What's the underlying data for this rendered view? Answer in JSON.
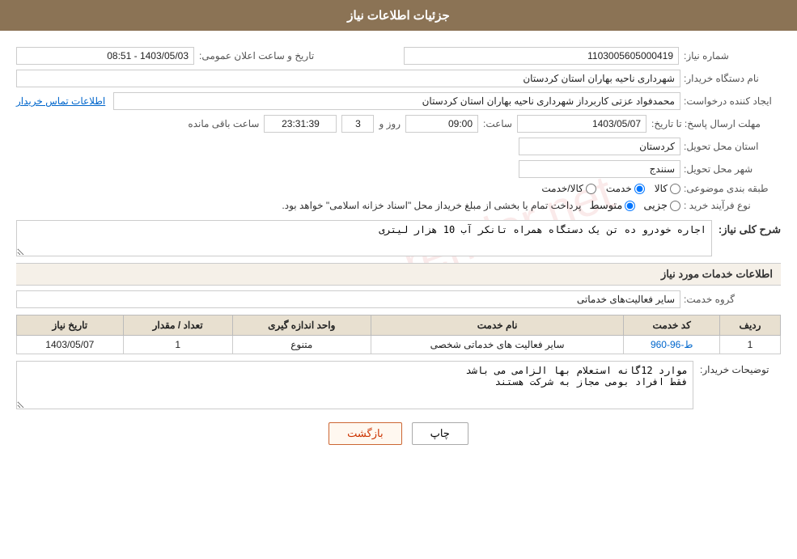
{
  "header": {
    "title": "جزئيات اطلاعات نياز"
  },
  "fields": {
    "shenmareh_niaz_label": "شماره نياز:",
    "shenmareh_niaz_value": "1103005605000419",
    "name_dastgah_label": "نام دستگاه خريدار:",
    "name_dastgah_value": "شهرداری ناحيه بهاران استان کردستان",
    "ijad_konandeh_label": "ايجاد کننده درخواست:",
    "ijad_konandeh_value": "محمدفواد عزتی کاربرداز شهرداری ناحيه بهاران استان کردستان",
    "ettelaat_link": "اطلاعات تماس خريدار",
    "mohlet_ersal_label": "مهلت ارسال پاسخ: تا تاريخ:",
    "date_value": "1403/05/07",
    "saaat_label": "ساعت:",
    "saat_value": "09:00",
    "rooz_label": "روز و",
    "rooz_value": "3",
    "remaining_label": "ساعت باقی مانده",
    "remaining_value": "23:31:39",
    "ostan_label": "استان محل تحويل:",
    "ostan_value": "کردستان",
    "shahr_label": "شهر محل تحويل:",
    "shahr_value": "سنندج",
    "tabaqe_label": "طبقه بندی موضوعی:",
    "kala_label": "کالا",
    "khedmat_label": "خدمت",
    "kala_khedmat_label": "کالا/خدمت",
    "nooe_farayand_label": "نوع فرآيند خريد :",
    "jozii_label": "جزيی",
    "motavaset_label": "متوسط",
    "nooe_farayand_note": "پرداخت تمام يا بخشی از مبلغ خريداز محل \"اسناد خزانه اسلامی\" خواهد بود.",
    "sharh_niaz_title": "شرح کلی نياز:",
    "sharh_niaz_value": "اجاره خودرو ده تن يک دستگاه همراه تانکر آب 10 هزار ليتری",
    "ettelaat_khadamat_title": "اطلاعات خدمات مورد نياز",
    "goroh_khedmat_label": "گروه خدمت:",
    "goroh_khedmat_value": "ساير فعاليت‌های خدماتی",
    "tafzih_label": "توضيحات خريدار:",
    "tafzih_value": "موارد 12گانه استعلام بها الزامی می باشد\nفقط افراد بومی مجاز به شرکت هستند",
    "table": {
      "headers": [
        "رديف",
        "کد خدمت",
        "نام خدمت",
        "واحد اندازه گيری",
        "تعداد / مقدار",
        "تاريخ نياز"
      ],
      "rows": [
        {
          "radif": "1",
          "code": "ط-96-960",
          "name": "ساير فعاليت های خدماتی شخصی",
          "unit": "متنوع",
          "count": "1",
          "date": "1403/05/07"
        }
      ]
    },
    "btn_print": "چاپ",
    "btn_back": "بازگشت",
    "tarikh_saaat_label": "تاريخ و ساعت اعلان عمومی:",
    "tarikh_saaat_value": "1403/05/03 - 08:51"
  }
}
